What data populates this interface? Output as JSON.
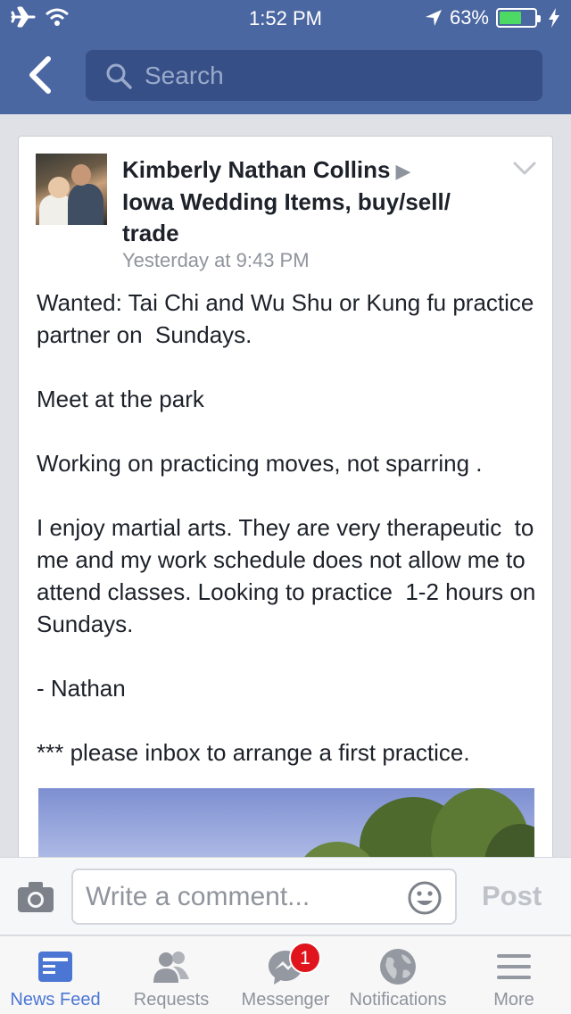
{
  "status_bar": {
    "time": "1:52 PM",
    "battery_percent": "63%",
    "battery_level": 0.63,
    "icons": [
      "airplane-icon",
      "wifi-icon",
      "location-arrow-icon",
      "battery-icon",
      "charging-bolt-icon"
    ]
  },
  "nav": {
    "back_icon": "chevron-left-icon",
    "search_placeholder": "Search"
  },
  "post": {
    "author": "Kimberly Nathan Collins",
    "group": "Iowa Wedding Items, buy/sell/ trade",
    "timestamp": "Yesterday at 9:43 PM",
    "paragraphs": [
      "Wanted: Tai Chi and Wu Shu or Kung fu practice partner on  Sundays.",
      "Meet at the park",
      "Working on practicing moves, not sparring .",
      "I enjoy martial arts. They are very therapeutic  to me and my work schedule does not allow me to  attend classes. Looking to practice  1-2 hours on Sundays.",
      "- Nathan",
      "*** please inbox to arrange a first practice."
    ]
  },
  "comment": {
    "placeholder": "Write a comment...",
    "post_label": "Post"
  },
  "tabs": [
    {
      "label": "News Feed",
      "icon": "news-feed-icon",
      "active": true
    },
    {
      "label": "Requests",
      "icon": "friends-icon",
      "active": false
    },
    {
      "label": "Messenger",
      "icon": "messenger-icon",
      "active": false,
      "badge": "1"
    },
    {
      "label": "Notifications",
      "icon": "globe-icon",
      "active": false
    },
    {
      "label": "More",
      "icon": "menu-icon",
      "active": false
    }
  ],
  "colors": {
    "brand_blue": "#4b67a1",
    "active_tab": "#4b76d3",
    "badge_red": "#e0141c"
  }
}
